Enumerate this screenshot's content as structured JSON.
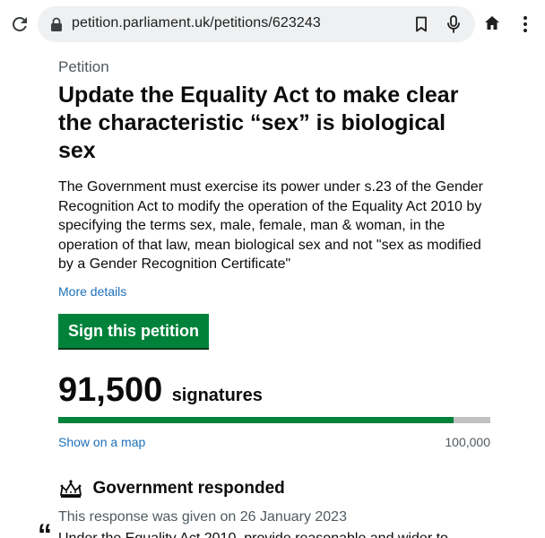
{
  "browser": {
    "url": "petition.parliament.uk/petitions/623243",
    "icons": [
      "reload-icon",
      "lock-icon",
      "bookmark-icon",
      "microphone-icon",
      "home-icon",
      "more-vertical-icon"
    ]
  },
  "petition": {
    "eyebrow": "Petition",
    "title": "Update the Equality Act to make clear the characteristic “sex” is biological sex",
    "description": "The Government must exercise its power under s.23 of the Gender Recognition Act to modify the operation of the Equality Act 2010 by specifying the terms sex, male, female, man & woman, in the operation of that law, mean biological sex and not \"sex as modified by a Gender Recognition Certificate\"",
    "more_details_label": "More details",
    "sign_label": "Sign this petition"
  },
  "signatures": {
    "count": "91,500",
    "label": "signatures",
    "goal": "100,000",
    "progress_fraction": 0.915,
    "map_link_label": "Show on a map"
  },
  "response": {
    "heading": "Government responded",
    "date_text": "This response was given on 26 January 2023",
    "quote_mark": "“",
    "quote_start": "Under the Equality Act 2010, provide reasonable and wider to"
  },
  "colors": {
    "accent_green": "#00823b",
    "link_blue": "#1d70b8",
    "secondary_text": "#505a5f",
    "progress_track": "#bfc1c3"
  }
}
